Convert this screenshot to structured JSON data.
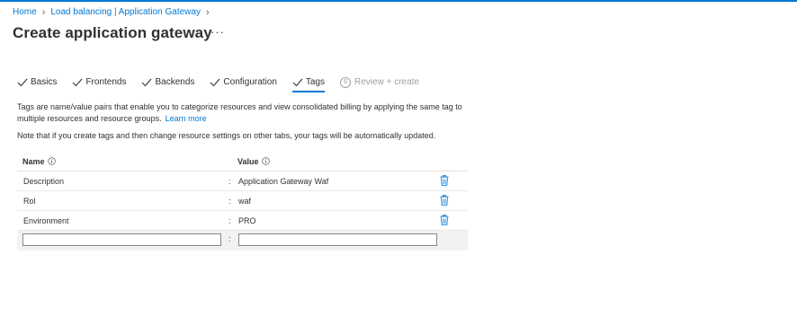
{
  "breadcrumb": {
    "items": [
      "Home",
      "Load balancing | Application Gateway"
    ]
  },
  "page": {
    "title": "Create application gateway",
    "more": "···"
  },
  "tabs": [
    {
      "label": "Basics",
      "state": "done"
    },
    {
      "label": "Frontends",
      "state": "done"
    },
    {
      "label": "Backends",
      "state": "done"
    },
    {
      "label": "Configuration",
      "state": "done"
    },
    {
      "label": "Tags",
      "state": "active"
    },
    {
      "label": "Review + create",
      "state": "disabled",
      "step": "6"
    }
  ],
  "description": {
    "text": "Tags are name/value pairs that enable you to categorize resources and view consolidated billing by applying the same tag to multiple resources and resource groups.",
    "link": "Learn more"
  },
  "note": "Note that if you create tags and then change resource settings on other tabs, your tags will be automatically updated.",
  "table": {
    "headers": {
      "name": "Name",
      "value": "Value"
    },
    "separator": ":",
    "rows": [
      {
        "name": "Description",
        "value": "Application Gateway Waf"
      },
      {
        "name": "Rol",
        "value": "waf"
      },
      {
        "name": "Environment",
        "value": "PRO"
      }
    ],
    "new_row": {
      "name": "",
      "value": ""
    }
  },
  "colors": {
    "accent": "#0078d4",
    "delete_icon": "#0078d4",
    "disabled": "#a19f9d"
  }
}
